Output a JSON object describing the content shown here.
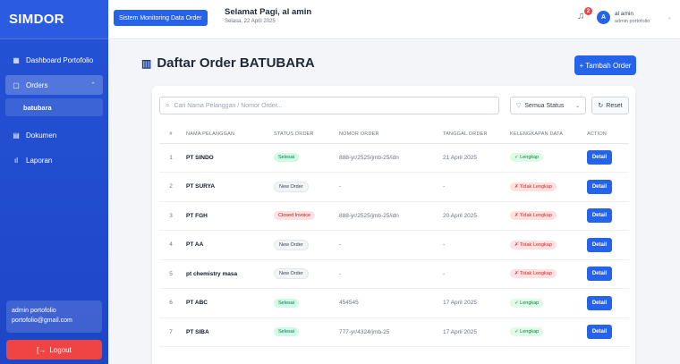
{
  "app": {
    "brand": "SIMDOR"
  },
  "sidebar": {
    "items": [
      {
        "label": "Dashboard Portofolio",
        "icon": "grid-icon"
      },
      {
        "label": "Orders",
        "icon": "folder-icon"
      },
      {
        "label": "batubara"
      },
      {
        "label": "Dokumen",
        "icon": "document-icon"
      },
      {
        "label": "Laporan",
        "icon": "chart-icon"
      }
    ],
    "user": {
      "name": "admin portofolio",
      "email": "portofolio@gmail.com"
    },
    "logout_label": "Logout"
  },
  "topbar": {
    "app_badge": "Sistem Monitoring Data Order",
    "greeting": "Selamat Pagi, al amin",
    "date": "Selasa, 22 April 2025",
    "notif_count": "2",
    "avatar_letter": "A",
    "user_name": "al amin",
    "user_role": "admin portofolio"
  },
  "main": {
    "title": "Daftar Order BATUBARA",
    "add_label": "+ Tambah Order",
    "search_placeholder": "Cari Nama Pelanggan / Nomor Order...",
    "filter_value": "Semua Status",
    "reset_label": "Reset",
    "columns": [
      "#",
      "NAMA PELANGGAN",
      "STATUS ORDER",
      "NOMOR ORDER",
      "TANGGAL ORDER",
      "KELENGKAPAN DATA",
      "ACTION"
    ],
    "rows": [
      {
        "no": "1",
        "nama": "PT SINDO",
        "status": "Selesai",
        "nomor": "888-yr/2525/jmb-25/idn",
        "tanggal": "21 April 2025",
        "kelengkapan": "✓ Lengkap",
        "action": "Detail"
      },
      {
        "no": "2",
        "nama": "PT SURYA",
        "status": "New Order",
        "nomor": "-",
        "tanggal": "-",
        "kelengkapan": "✗ Tidak Lengkap",
        "action": "Detail"
      },
      {
        "no": "3",
        "nama": "PT FGH",
        "status": "Closed Invoice",
        "nomor": "888-yr/2525/jmb-25/idn",
        "tanggal": "20 April 2025",
        "kelengkapan": "✗ Tidak Lengkap",
        "action": "Detail"
      },
      {
        "no": "4",
        "nama": "PT AA",
        "status": "New Order",
        "nomor": "-",
        "tanggal": "-",
        "kelengkapan": "✗ Tidak Lengkap",
        "action": "Detail"
      },
      {
        "no": "5",
        "nama": "pt chemistry masa",
        "status": "New Order",
        "nomor": "-",
        "tanggal": "-",
        "kelengkapan": "✗ Tidak Lengkap",
        "action": "Detail"
      },
      {
        "no": "6",
        "nama": "PT ABC",
        "status": "Selesai",
        "nomor": "454545",
        "tanggal": "17 April 2025",
        "kelengkapan": "✓ Lengkap",
        "action": "Detail"
      },
      {
        "no": "7",
        "nama": "PT SIBA",
        "status": "Selesai",
        "nomor": "777-yr/4324/jmb-25",
        "tanggal": "17 April 2025",
        "kelengkapan": "✓ Lengkap",
        "action": "Detail"
      }
    ]
  },
  "colors": {
    "primary": "#2563eb",
    "sidebar": "#1e46c7",
    "danger": "#ef4444",
    "success": "#047857"
  }
}
